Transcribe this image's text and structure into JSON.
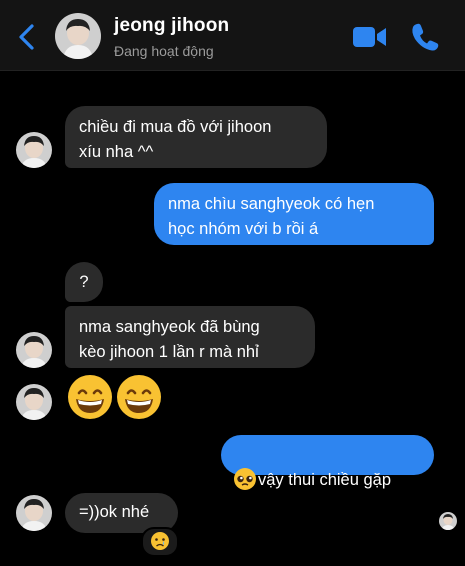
{
  "header": {
    "name": "jeong jihoon",
    "status": "Đang hoạt động",
    "back_icon": "chevron-left-icon",
    "video_icon": "video-camera-icon",
    "call_icon": "phone-icon",
    "accent_color": "#2e85f0"
  },
  "messages": [
    {
      "sender": "them",
      "text": "chiều đi mua đồ với jihoon\nxíu nha ^^"
    },
    {
      "sender": "me",
      "text": "nma chìu sanghyeok có hẹn\nhọc nhóm với b rồi á"
    },
    {
      "sender": "them",
      "text": "?"
    },
    {
      "sender": "them",
      "text": "nma sanghyeok đã bùng\nkèo jihoon 1 lần r mà nhỉ"
    },
    {
      "sender": "them",
      "emoji": "grinning-face-with-smiling-eyes x2"
    },
    {
      "sender": "me",
      "emoji_prefix": "pleading-face",
      "text": "vậy thui chiều gặp"
    },
    {
      "sender": "them",
      "text": "=))ok nhé",
      "reaction": "crying-face"
    }
  ],
  "colors": {
    "incoming_bubble": "#2b2b2b",
    "outgoing_bubble": "#2e85f0",
    "background": "#000000"
  }
}
